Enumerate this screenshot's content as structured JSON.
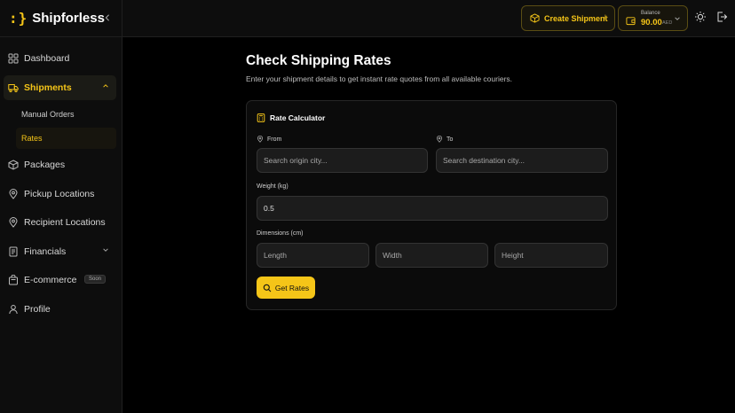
{
  "app": {
    "logo_mark": ":}",
    "name": "Shipforless"
  },
  "sidebar": {
    "items": [
      {
        "label": "Dashboard",
        "icon": "dashboard-icon"
      },
      {
        "label": "Shipments",
        "icon": "truck-icon",
        "active": true,
        "expanded": true,
        "children": [
          {
            "label": "Manual Orders"
          },
          {
            "label": "Rates",
            "active": true
          }
        ]
      },
      {
        "label": "Packages",
        "icon": "package-icon"
      },
      {
        "label": "Pickup Locations",
        "icon": "map-pin-icon"
      },
      {
        "label": "Recipient Locations",
        "icon": "map-pin-icon"
      },
      {
        "label": "Financials",
        "icon": "receipt-icon"
      },
      {
        "label": "E-commerce",
        "icon": "shopping-bag-icon",
        "badge": "Soon"
      },
      {
        "label": "Profile",
        "icon": "user-icon"
      }
    ]
  },
  "topbar": {
    "create_label": "Create Shipment",
    "balance_label": "Balance",
    "balance_amount": "90.00",
    "balance_currency": "AED"
  },
  "page": {
    "title": "Check Shipping Rates",
    "subtitle": "Enter your shipment details to get instant rate quotes from all available couriers."
  },
  "calculator": {
    "title": "Rate Calculator",
    "from_label": "From",
    "from_placeholder": "Search origin city...",
    "to_label": "To",
    "to_placeholder": "Search destination city...",
    "weight_label": "Weight (kg)",
    "weight_value": "0.5",
    "dimensions_label": "Dimensions (cm)",
    "length_placeholder": "Length",
    "width_placeholder": "Width",
    "height_placeholder": "Height",
    "submit_label": "Get Rates"
  },
  "colors": {
    "accent": "#f5c518",
    "background": "#000000",
    "sidebar": "#0d0d0d"
  }
}
